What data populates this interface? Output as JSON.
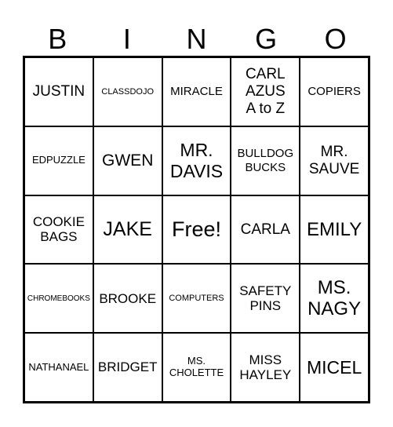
{
  "header": {
    "letters": [
      "B",
      "I",
      "N",
      "G",
      "O"
    ]
  },
  "rows": [
    [
      "JUSTIN",
      "CLASSDOJO",
      "MIRACLE",
      "CARL\nAZUS\nA to Z",
      "COPIERS"
    ],
    [
      "EDPUZZLE",
      "GWEN",
      "MR.\nDAVIS",
      "BULLDOG\nBUCKS",
      "MR.\nSAUVE"
    ],
    [
      "COOKIE\nBAGS",
      "JAKE",
      "Free!",
      "CARLA",
      "EMILY"
    ],
    [
      "CHROMEBOOKS",
      "BROOKE",
      "COMPUTERS",
      "SAFETY\nPINS",
      "MS.\nNAGY"
    ],
    [
      "NATHANAEL",
      "BRIDGET",
      "MS.\nCHOLETTE",
      "MISS\nHAYLEY",
      "MICEL"
    ]
  ]
}
